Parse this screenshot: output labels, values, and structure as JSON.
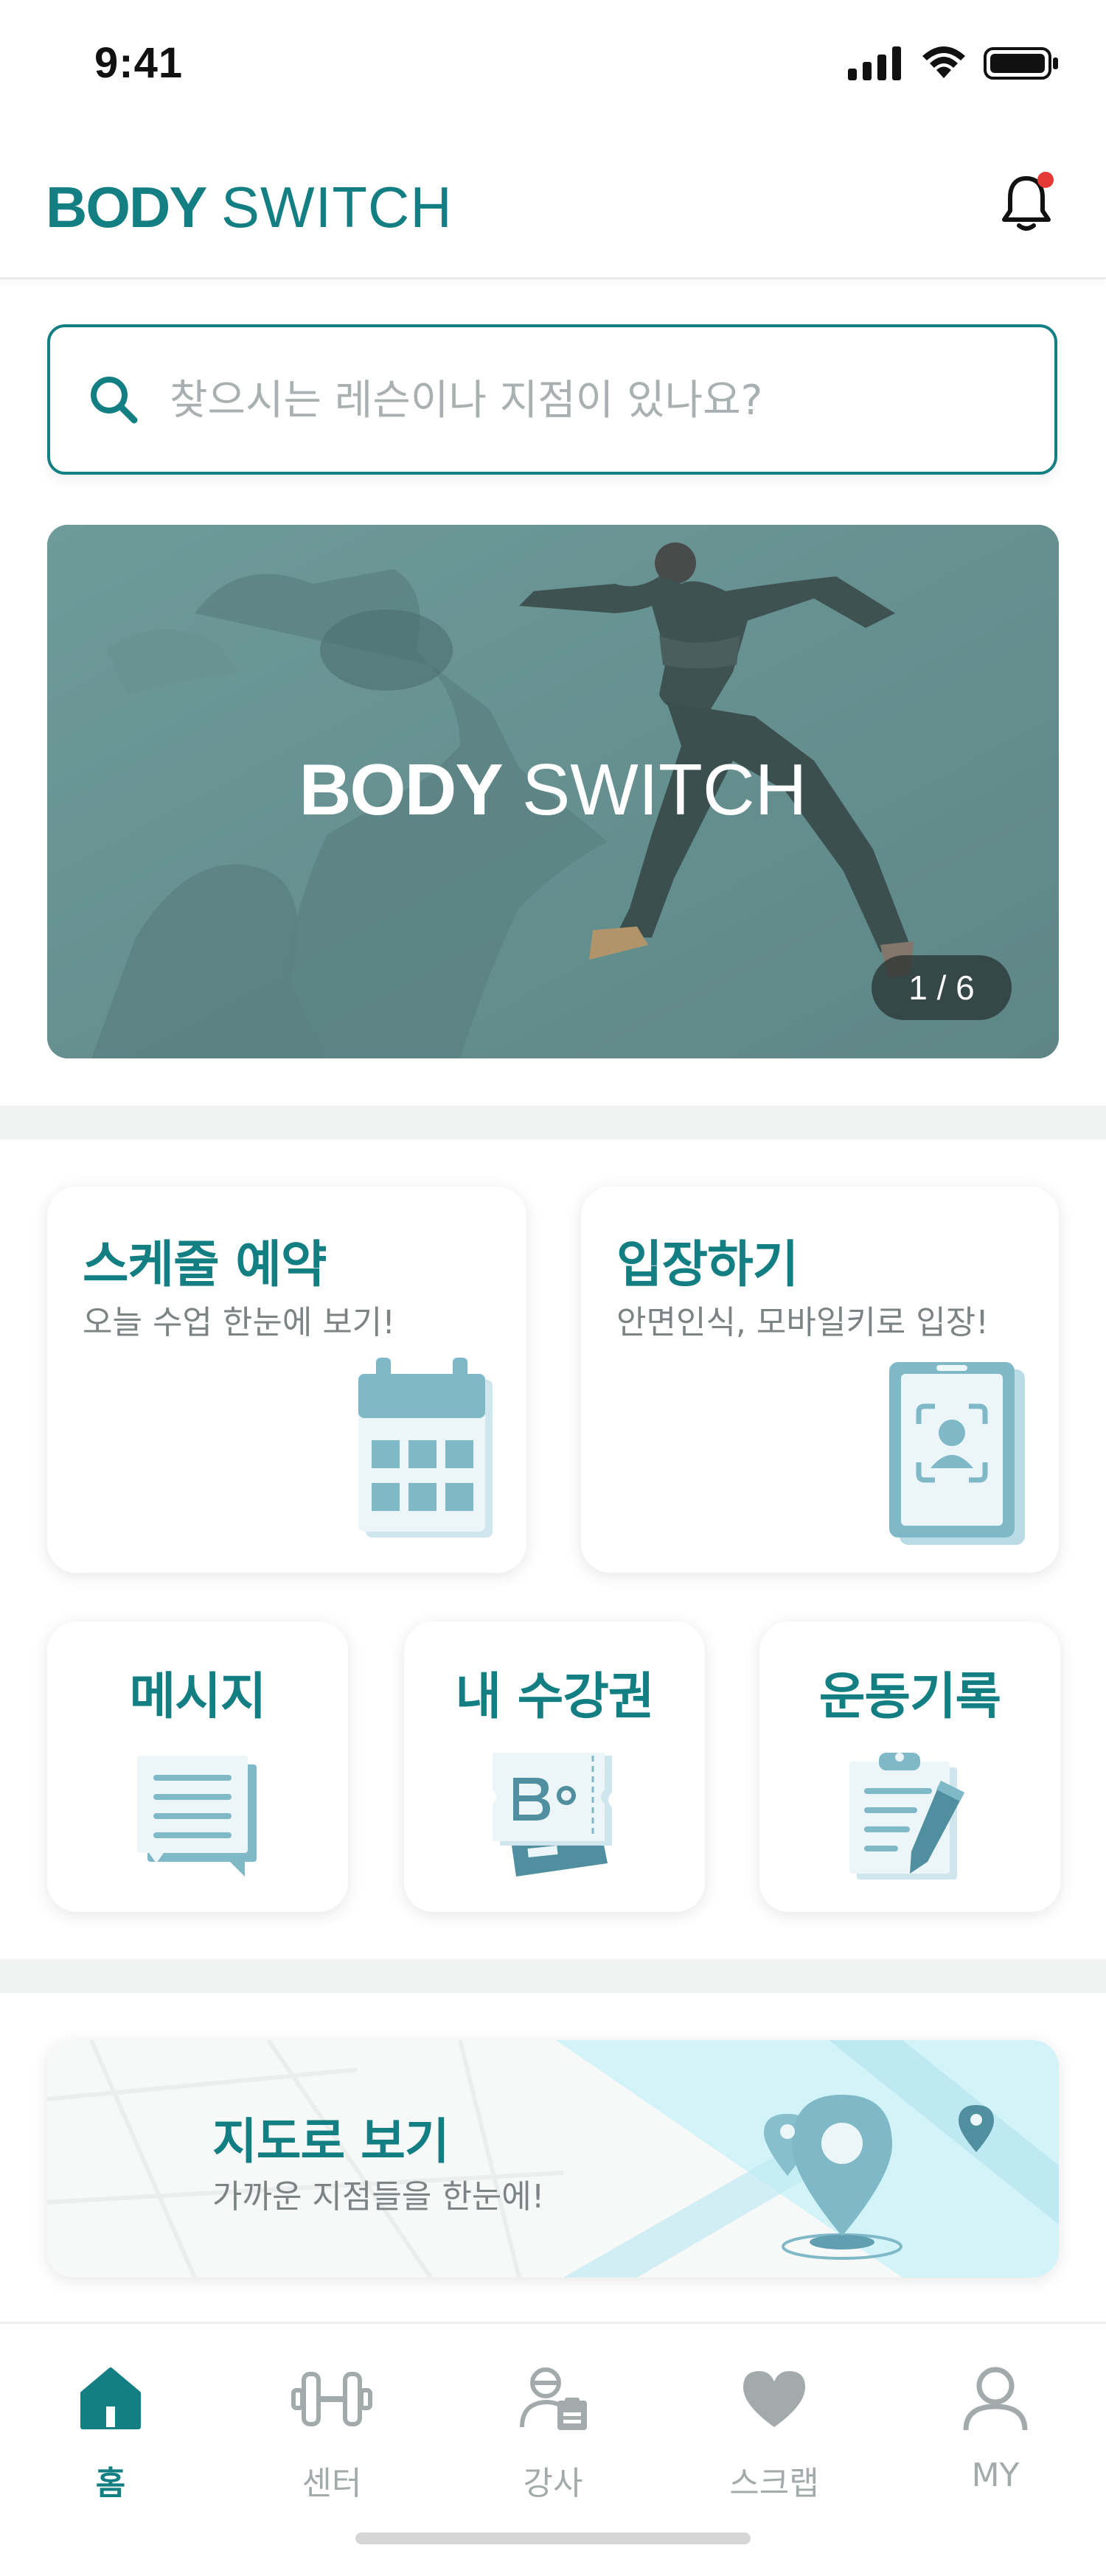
{
  "status_bar": {
    "time": "9:41"
  },
  "header": {
    "logo_bold": "BODY",
    "logo_light": "SWITCH",
    "notification_dot_color": "#e53935"
  },
  "search": {
    "placeholder": "찾으시는 레슨이나 지점이 있나요?"
  },
  "banner": {
    "logo_bold": "BODY",
    "logo_light": "SWITCH",
    "counter": "1 / 6",
    "current_slide": 1,
    "total_slides": 6
  },
  "cards": {
    "schedule": {
      "title": "스케줄 예약",
      "subtitle": "오늘 수업 한눈에 보기!",
      "icon": "calendar-icon"
    },
    "entry": {
      "title": "입장하기",
      "subtitle": "안면인식, 모바일키로 입장!",
      "icon": "face-id-phone-icon"
    },
    "message": {
      "title": "메시지",
      "icon": "message-icon"
    },
    "pass": {
      "title": "내 수강권",
      "icon": "ticket-icon"
    },
    "record": {
      "title": "운동기록",
      "icon": "clipboard-icon"
    }
  },
  "map_card": {
    "title": "지도로 보기",
    "subtitle": "가까운 지점들을 한눈에!",
    "icon": "map-pin-icon"
  },
  "tabbar": {
    "items": [
      {
        "label": "홈",
        "icon": "home-icon",
        "active": true
      },
      {
        "label": "센터",
        "icon": "dumbbell-icon",
        "active": false
      },
      {
        "label": "강사",
        "icon": "instructor-icon",
        "active": false
      },
      {
        "label": "스크랩",
        "icon": "heart-icon",
        "active": false
      },
      {
        "label": "MY",
        "icon": "user-icon",
        "active": false
      }
    ]
  },
  "colors": {
    "accent": "#137f83",
    "icon_blue": "#7fb9c8",
    "icon_light": "#e4f3f8",
    "inactive": "#a3aaab"
  }
}
